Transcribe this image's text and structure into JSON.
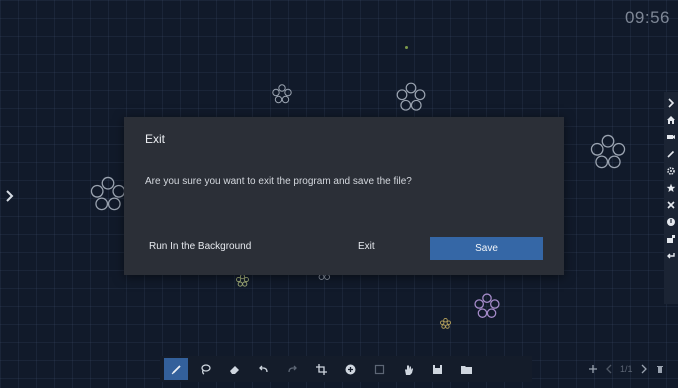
{
  "status": {
    "clock": "09:56"
  },
  "dialog": {
    "title": "Exit",
    "message": "Are you sure you want to exit the program and save the file?",
    "background_label": "Run In the Background",
    "exit_label": "Exit",
    "save_label": "Save"
  },
  "page_nav": {
    "indicator": "1/1"
  },
  "right_toolbar": {
    "items": [
      "collapse-chevron-icon",
      "home-icon",
      "screen-record-icon",
      "pen-icon",
      "settings-icon",
      "favorite-star-icon",
      "tools-icon",
      "info-icon",
      "camera-icon",
      "exit-return-icon"
    ]
  },
  "bottom_toolbar": {
    "items": [
      "pen-icon",
      "lasso-select-icon",
      "eraser-icon",
      "undo-icon",
      "redo-icon",
      "crop-icon",
      "add-circle-icon",
      "shape-square-icon",
      "hand-pan-icon",
      "save-icon",
      "folder-icon"
    ]
  },
  "colors": {
    "background": "#111a2a",
    "dialog": "#2b2f37",
    "accent": "#3567a6",
    "toolbar": "#141c2a"
  }
}
